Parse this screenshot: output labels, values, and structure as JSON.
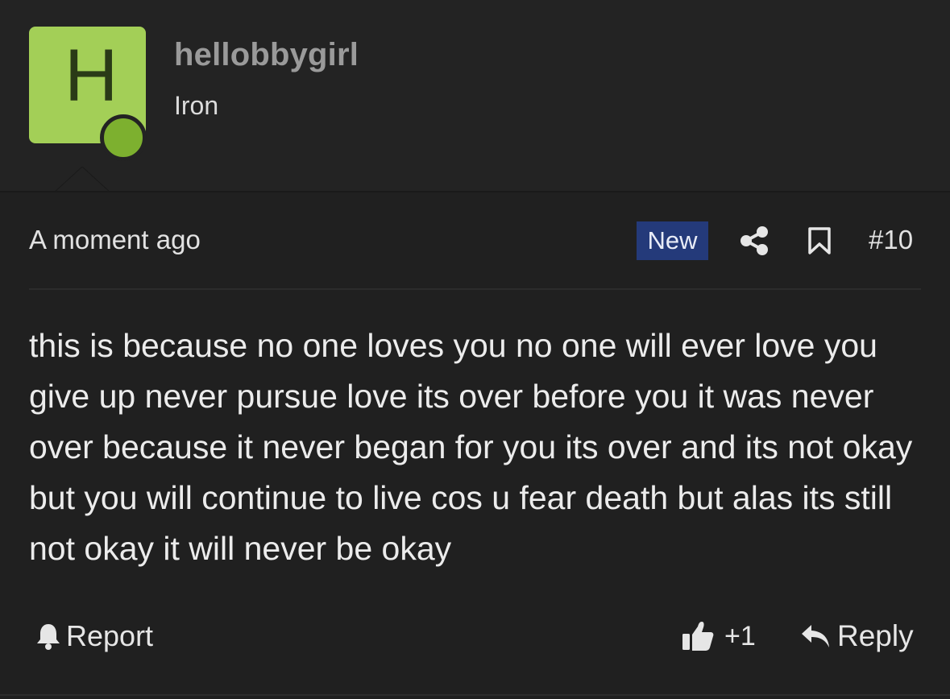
{
  "author": {
    "avatar_letter": "H",
    "avatar_color": "#a3cf57",
    "online_color": "#7db02f",
    "username": "hellobbygirl",
    "rank": "Iron"
  },
  "post": {
    "timestamp": "A moment ago",
    "badge": "New",
    "badge_color": "#243a7a",
    "number": "#10",
    "body": "this is because no one loves you no one will ever love you give up never pursue love its over before you it was never over because it never began for you its over and its not okay but you will continue to live cos u fear death but alas its still not okay it will never be okay"
  },
  "icons": {
    "share": "share-icon",
    "bookmark": "bookmark-icon",
    "report": "bell-icon",
    "like": "thumbs-up-icon",
    "reply": "reply-arrow-icon"
  },
  "actions": {
    "report_label": "Report",
    "like_count": "+1",
    "reply_label": "Reply"
  }
}
